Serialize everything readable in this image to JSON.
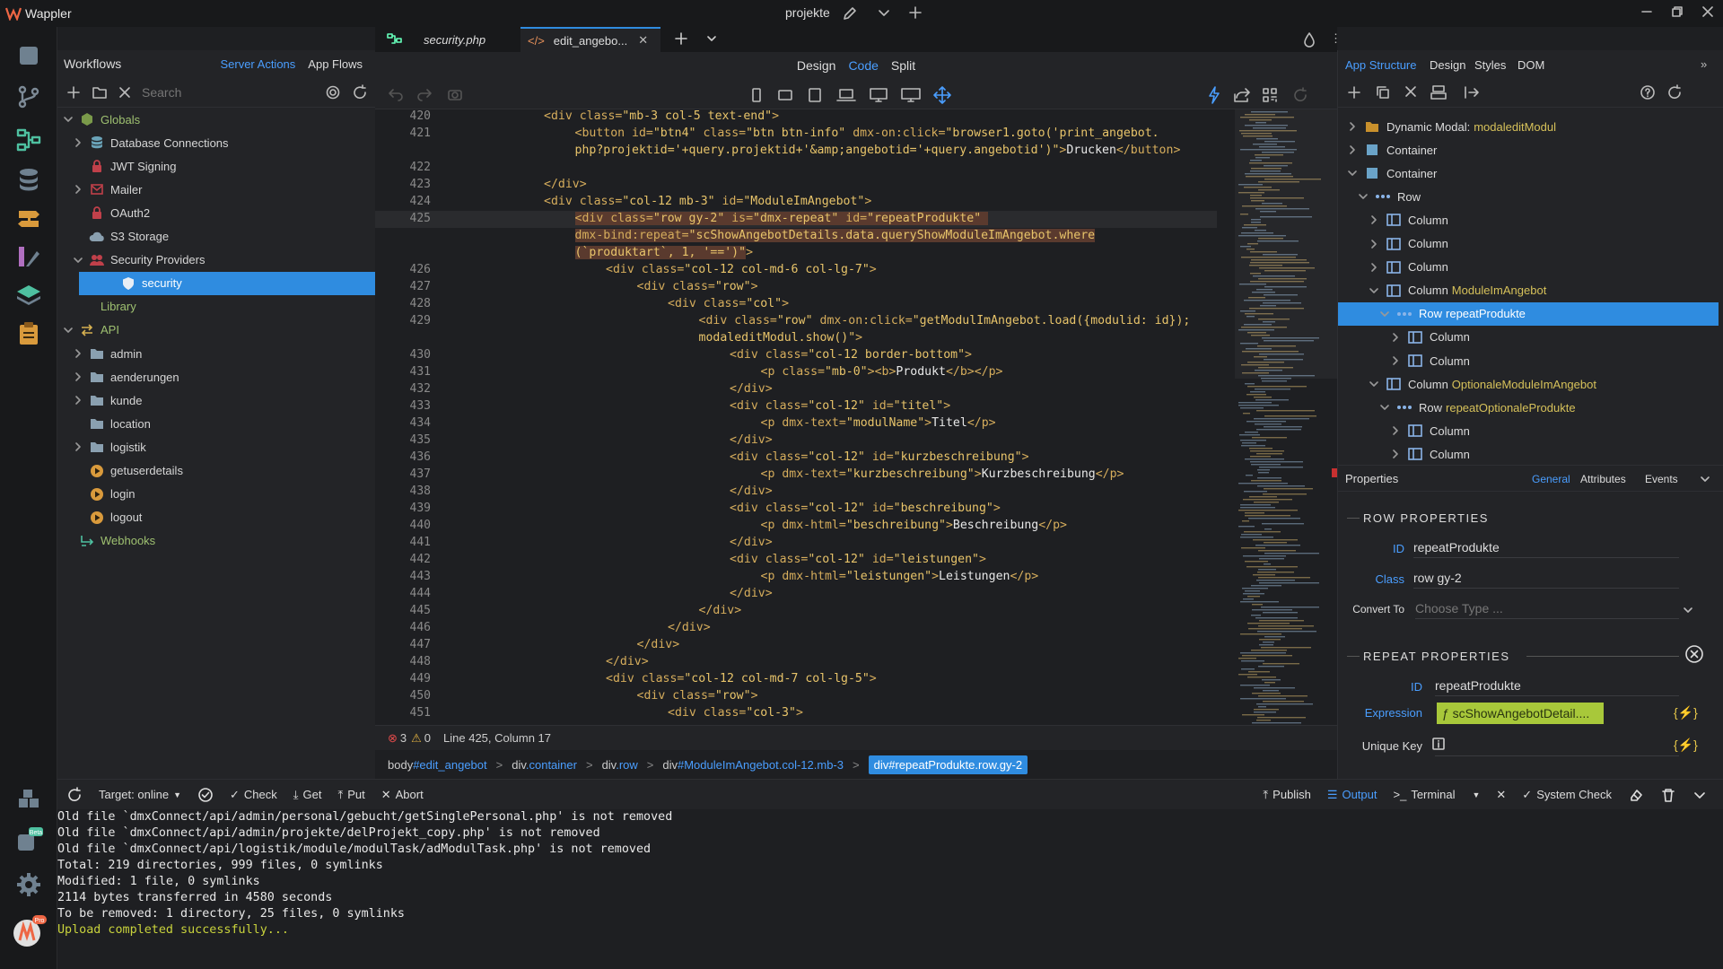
{
  "app": {
    "name": "Wappler",
    "project": "projekte"
  },
  "workflows": {
    "title": "Workflows",
    "tabs": [
      "Server Actions",
      "App Flows"
    ],
    "search_placeholder": "Search",
    "tree": [
      {
        "label": "Globals",
        "icon": "globe-icon",
        "level": 0,
        "chevron": "down"
      },
      {
        "label": "Database Connections",
        "icon": "database-icon",
        "level": 1,
        "chevron": "right"
      },
      {
        "label": "JWT Signing",
        "icon": "lock-icon",
        "level": 1,
        "chevron": ""
      },
      {
        "label": "Mailer",
        "icon": "mail-icon",
        "level": 1,
        "chevron": "right"
      },
      {
        "label": "OAuth2",
        "icon": "lock-icon",
        "level": 1,
        "chevron": ""
      },
      {
        "label": "S3 Storage",
        "icon": "cloud-icon",
        "level": 1,
        "chevron": ""
      },
      {
        "label": "Security Providers",
        "icon": "users-icon",
        "level": 1,
        "chevron": "down"
      },
      {
        "label": "security",
        "icon": "shield-icon",
        "level": 2,
        "chevron": "",
        "selected": true
      },
      {
        "label": "Library",
        "icon": "",
        "level": 0,
        "chevron": ""
      },
      {
        "label": "API",
        "icon": "exchange-icon",
        "level": 0,
        "chevron": "down"
      },
      {
        "label": "admin",
        "icon": "folder-icon",
        "level": 1,
        "chevron": "right"
      },
      {
        "label": "aenderungen",
        "icon": "folder-icon",
        "level": 1,
        "chevron": "right"
      },
      {
        "label": "kunde",
        "icon": "folder-icon",
        "level": 1,
        "chevron": "right"
      },
      {
        "label": "location",
        "icon": "folder-icon",
        "level": 1,
        "chevron": ""
      },
      {
        "label": "logistik",
        "icon": "folder-icon",
        "level": 1,
        "chevron": "right"
      },
      {
        "label": "getuserdetails",
        "icon": "play-icon",
        "level": 1,
        "chevron": ""
      },
      {
        "label": "login",
        "icon": "play-icon",
        "level": 1,
        "chevron": ""
      },
      {
        "label": "logout",
        "icon": "play-icon",
        "level": 1,
        "chevron": ""
      },
      {
        "label": "Webhooks",
        "icon": "webhook-icon",
        "level": 0,
        "chevron": ""
      }
    ]
  },
  "editor": {
    "tabs": [
      {
        "label": "security.php",
        "active": false
      },
      {
        "label": "edit_angebo...",
        "active": true
      }
    ],
    "views": [
      "Design",
      "Code",
      "Split"
    ],
    "active_view": "Code",
    "lines": [
      {
        "n": "420",
        "html": "<span class=\"tg\">&lt;div</span> <span class=\"at\">class=</span><span class=\"st\">\"mb-3 col-5 text-end\"</span><span class=\"tg\">&gt;</span>",
        "indent": 0
      },
      {
        "n": "421",
        "html": "<span class=\"tg\">&lt;button</span> <span class=\"at\">id=</span><span class=\"st\">\"btn4\"</span> <span class=\"at\">class=</span><span class=\"st\">\"btn btn-info\"</span> <span class=\"at\">dmx-on:click=</span><span class=\"st\">\"browser1.goto('print_angebot.</span>",
        "indent": 1
      },
      {
        "n": "",
        "html": "<span class=\"st\">php?projektid='+query.projektid+'&amp;amp;angebotid='+query.angebotid')\"</span><span class=\"tg\">&gt;</span><span class=\"tx\">Drucken</span><span class=\"tg\">&lt;/button&gt;</span>",
        "indent": 1
      },
      {
        "n": "422",
        "html": "",
        "indent": 0
      },
      {
        "n": "423",
        "html": "<span class=\"tg\">&lt;/div&gt;</span>",
        "indent": 0
      },
      {
        "n": "424",
        "html": "<span class=\"tg\">&lt;div</span> <span class=\"at\">class=</span><span class=\"st\">\"col-12 mb-3\"</span> <span class=\"at\">id=</span><span class=\"st\">\"ModuleImAngebot\"</span><span class=\"tg\">&gt;</span>",
        "indent": 0
      },
      {
        "n": "425",
        "html": "<span style=\"background:#5a3a2e\"><span class=\"tg\">&lt;div</span> <span class=\"at\">class=</span><span class=\"st\">\"row gy-2\"</span> <span class=\"at\">is=</span><span class=\"st\">\"dmx-repeat\"</span> <span class=\"at\">id=</span><span class=\"st\">\"repeatProdukte\"</span> </span>",
        "indent": 1
      },
      {
        "n": "",
        "html": "<span style=\"background:#5a3a2e\"><span class=\"at\">dmx-bind:repeat=</span><span class=\"st\">\"scShowAngebotDetails.data.queryShowModuleImAngebot.where</span></span>",
        "indent": 1
      },
      {
        "n": "",
        "html": "<span style=\"background:#5a3a2e\"><span class=\"st\">(`produktart`, 1, '==')\"</span></span><span class=\"tg\">&gt;</span>",
        "indent": 1
      },
      {
        "n": "426",
        "html": "<span class=\"tg\">&lt;div</span> <span class=\"at\">class=</span><span class=\"st\">\"col-12 col-md-6 col-lg-7\"</span><span class=\"tg\">&gt;</span>",
        "indent": 2
      },
      {
        "n": "427",
        "html": "<span class=\"tg\">&lt;div</span> <span class=\"at\">class=</span><span class=\"st\">\"row\"</span><span class=\"tg\">&gt;</span>",
        "indent": 3
      },
      {
        "n": "428",
        "html": "<span class=\"tg\">&lt;div</span> <span class=\"at\">class=</span><span class=\"st\">\"col\"</span><span class=\"tg\">&gt;</span>",
        "indent": 4
      },
      {
        "n": "429",
        "html": "<span class=\"tg\">&lt;div</span> <span class=\"at\">class=</span><span class=\"st\">\"row\"</span> <span class=\"at\">dmx-on:click=</span><span class=\"st\">\"getModulImAngebot.load({modulid: id});</span>",
        "indent": 5
      },
      {
        "n": "",
        "html": "<span class=\"st\">modaleditModul.show()\"</span><span class=\"tg\">&gt;</span>",
        "indent": 5
      },
      {
        "n": "430",
        "html": "<span class=\"tg\">&lt;div</span> <span class=\"at\">class=</span><span class=\"st\">\"col-12 border-bottom\"</span><span class=\"tg\">&gt;</span>",
        "indent": 6
      },
      {
        "n": "431",
        "html": "<span class=\"tg\">&lt;p</span> <span class=\"at\">class=</span><span class=\"st\">\"mb-0\"</span><span class=\"tg\">&gt;&lt;b&gt;</span><span class=\"tx\">Produkt</span><span class=\"tg\">&lt;/b&gt;&lt;/p&gt;</span>",
        "indent": 7
      },
      {
        "n": "432",
        "html": "<span class=\"tg\">&lt;/div&gt;</span>",
        "indent": 6
      },
      {
        "n": "433",
        "html": "<span class=\"tg\">&lt;div</span> <span class=\"at\">class=</span><span class=\"st\">\"col-12\"</span> <span class=\"at\">id=</span><span class=\"st\">\"titel\"</span><span class=\"tg\">&gt;</span>",
        "indent": 6
      },
      {
        "n": "434",
        "html": "<span class=\"tg\">&lt;p</span> <span class=\"at\">dmx-text=</span><span class=\"st\">\"modulName\"</span><span class=\"tg\">&gt;</span><span class=\"tx\">Titel</span><span class=\"tg\">&lt;/p&gt;</span>",
        "indent": 7
      },
      {
        "n": "435",
        "html": "<span class=\"tg\">&lt;/div&gt;</span>",
        "indent": 6
      },
      {
        "n": "436",
        "html": "<span class=\"tg\">&lt;div</span> <span class=\"at\">class=</span><span class=\"st\">\"col-12\"</span> <span class=\"at\">id=</span><span class=\"st\">\"kurzbeschreibung\"</span><span class=\"tg\">&gt;</span>",
        "indent": 6
      },
      {
        "n": "437",
        "html": "<span class=\"tg\">&lt;p</span> <span class=\"at\">dmx-text=</span><span class=\"st\">\"kurzbeschreibung\"</span><span class=\"tg\">&gt;</span><span class=\"tx\">Kurzbeschreibung</span><span class=\"tg\">&lt;/p&gt;</span>",
        "indent": 7
      },
      {
        "n": "438",
        "html": "<span class=\"tg\">&lt;/div&gt;</span>",
        "indent": 6
      },
      {
        "n": "439",
        "html": "<span class=\"tg\">&lt;div</span> <span class=\"at\">class=</span><span class=\"st\">\"col-12\"</span> <span class=\"at\">id=</span><span class=\"st\">\"beschreibung\"</span><span class=\"tg\">&gt;</span>",
        "indent": 6
      },
      {
        "n": "440",
        "html": "<span class=\"tg\">&lt;p</span> <span class=\"at\">dmx-html=</span><span class=\"st\">\"beschreibung\"</span><span class=\"tg\">&gt;</span><span class=\"tx\">Beschreibung</span><span class=\"tg\">&lt;/p&gt;</span>",
        "indent": 7
      },
      {
        "n": "441",
        "html": "<span class=\"tg\">&lt;/div&gt;</span>",
        "indent": 6
      },
      {
        "n": "442",
        "html": "<span class=\"tg\">&lt;div</span> <span class=\"at\">class=</span><span class=\"st\">\"col-12\"</span> <span class=\"at\">id=</span><span class=\"st\">\"leistungen\"</span><span class=\"tg\">&gt;</span>",
        "indent": 6
      },
      {
        "n": "443",
        "html": "<span class=\"tg\">&lt;p</span> <span class=\"at\">dmx-html=</span><span class=\"st\">\"leistungen\"</span><span class=\"tg\">&gt;</span><span class=\"tx\">Leistungen</span><span class=\"tg\">&lt;/p&gt;</span>",
        "indent": 7
      },
      {
        "n": "444",
        "html": "<span class=\"tg\">&lt;/div&gt;</span>",
        "indent": 6
      },
      {
        "n": "445",
        "html": "<span class=\"tg\">&lt;/div&gt;</span>",
        "indent": 5
      },
      {
        "n": "446",
        "html": "<span class=\"tg\">&lt;/div&gt;</span>",
        "indent": 4
      },
      {
        "n": "447",
        "html": "<span class=\"tg\">&lt;/div&gt;</span>",
        "indent": 3
      },
      {
        "n": "448",
        "html": "<span class=\"tg\">&lt;/div&gt;</span>",
        "indent": 2
      },
      {
        "n": "449",
        "html": "<span class=\"tg\">&lt;div</span> <span class=\"at\">class=</span><span class=\"st\">\"col-12 col-md-7 col-lg-5\"</span><span class=\"tg\">&gt;</span>",
        "indent": 2
      },
      {
        "n": "450",
        "html": "<span class=\"tg\">&lt;div</span> <span class=\"at\">class=</span><span class=\"st\">\"row\"</span><span class=\"tg\">&gt;</span>",
        "indent": 3
      },
      {
        "n": "451",
        "html": "<span class=\"tg\">&lt;div</span> <span class=\"at\">class=</span><span class=\"st\">\"col-3\"</span><span class=\"tg\">&gt;</span>",
        "indent": 4
      }
    ],
    "status": {
      "errors": "3",
      "warnings": "0",
      "position": "Line 425, Column 17"
    },
    "breadcrumbs": [
      "body#edit_angebot",
      "div.container",
      "div.row",
      "div#ModuleImAngebot.col-12.mb-3",
      "div#repeatProdukte.row.gy-2"
    ]
  },
  "structure": {
    "tabs": [
      "App Structure",
      "Design",
      "Styles",
      "DOM"
    ],
    "active_tab": "App Structure",
    "tree": [
      {
        "label": "Dynamic Modal:",
        "extra": "modaleditModul",
        "icon": "modal-icon",
        "level": 0,
        "chevron": "right"
      },
      {
        "label": "Container",
        "extra": "",
        "icon": "container-icon",
        "level": 0,
        "chevron": "right"
      },
      {
        "label": "Container",
        "extra": "",
        "icon": "container-icon",
        "level": 0,
        "chevron": "down"
      },
      {
        "label": "Row",
        "extra": "",
        "icon": "row-icon",
        "level": 1,
        "chevron": "down"
      },
      {
        "label": "Column",
        "extra": "",
        "icon": "column-icon",
        "level": 2,
        "chevron": "right"
      },
      {
        "label": "Column",
        "extra": "",
        "icon": "column-icon",
        "level": 2,
        "chevron": "right"
      },
      {
        "label": "Column",
        "extra": "",
        "icon": "column-icon",
        "level": 2,
        "chevron": "right"
      },
      {
        "label": "Column",
        "extra": "ModuleImAngebot",
        "icon": "column-icon",
        "level": 2,
        "chevron": "down"
      },
      {
        "label": "Row",
        "extra": "repeatProdukte",
        "icon": "row-icon",
        "level": 3,
        "chevron": "down",
        "selected": true
      },
      {
        "label": "Column",
        "extra": "",
        "icon": "column-icon",
        "level": 4,
        "chevron": "right"
      },
      {
        "label": "Column",
        "extra": "",
        "icon": "column-icon",
        "level": 4,
        "chevron": "right"
      },
      {
        "label": "Column",
        "extra": "OptionaleModuleImAngebot",
        "icon": "column-icon",
        "level": 2,
        "chevron": "down"
      },
      {
        "label": "Row",
        "extra": "repeatOptionaleProdukte",
        "icon": "row-icon",
        "level": 3,
        "chevron": "down"
      },
      {
        "label": "Column",
        "extra": "",
        "icon": "column-icon",
        "level": 4,
        "chevron": "right"
      },
      {
        "label": "Column",
        "extra": "",
        "icon": "column-icon",
        "level": 4,
        "chevron": "right"
      }
    ]
  },
  "properties": {
    "title": "Properties",
    "tabs": [
      "General",
      "Attributes",
      "Events"
    ],
    "active_tab": "General",
    "row_section": "ROW PROPERTIES",
    "id_label": "ID",
    "id_value": "repeatProdukte",
    "class_label": "Class",
    "class_value": "row gy-2",
    "convert_label": "Convert To",
    "convert_placeholder": "Choose Type ...",
    "repeat_section": "REPEAT PROPERTIES",
    "repeat_id_label": "ID",
    "repeat_id_value": "repeatProdukte",
    "expression_label": "Expression",
    "expression_value": "ƒ scShowAngebotDetail....",
    "unique_label": "Unique Key"
  },
  "bottom": {
    "target_label": "Target: online",
    "check": "Check",
    "get": "Get",
    "put": "Put",
    "abort": "Abort",
    "publish": "Publish",
    "output": "Output",
    "terminal": "Terminal",
    "system_check": "System Check"
  },
  "console": [
    {
      "text": "Old file `dmxConnect/api/admin/personal/gebucht/getSinglePersonal.php' is not removed",
      "color": ""
    },
    {
      "text": "Old file `dmxConnect/api/admin/projekte/delProjekt_copy.php' is not removed",
      "color": ""
    },
    {
      "text": "Old file `dmxConnect/api/logistik/module/modulTask/adModulTask.php' is not removed",
      "color": ""
    },
    {
      "text": "Total: 219 directories, 999 files, 0 symlinks",
      "color": ""
    },
    {
      "text": "Modified: 1 file, 0 symlinks",
      "color": ""
    },
    {
      "text": "2114 bytes transferred in 4580 seconds",
      "color": ""
    },
    {
      "text": "To be removed: 1 directory, 25 files, 0 symlinks",
      "color": ""
    },
    {
      "text": "Upload completed successfully...",
      "color": "green"
    }
  ],
  "colors": {
    "accent": "#2f8ce0",
    "link": "#4a9eff",
    "extra": "#d6c15a"
  }
}
